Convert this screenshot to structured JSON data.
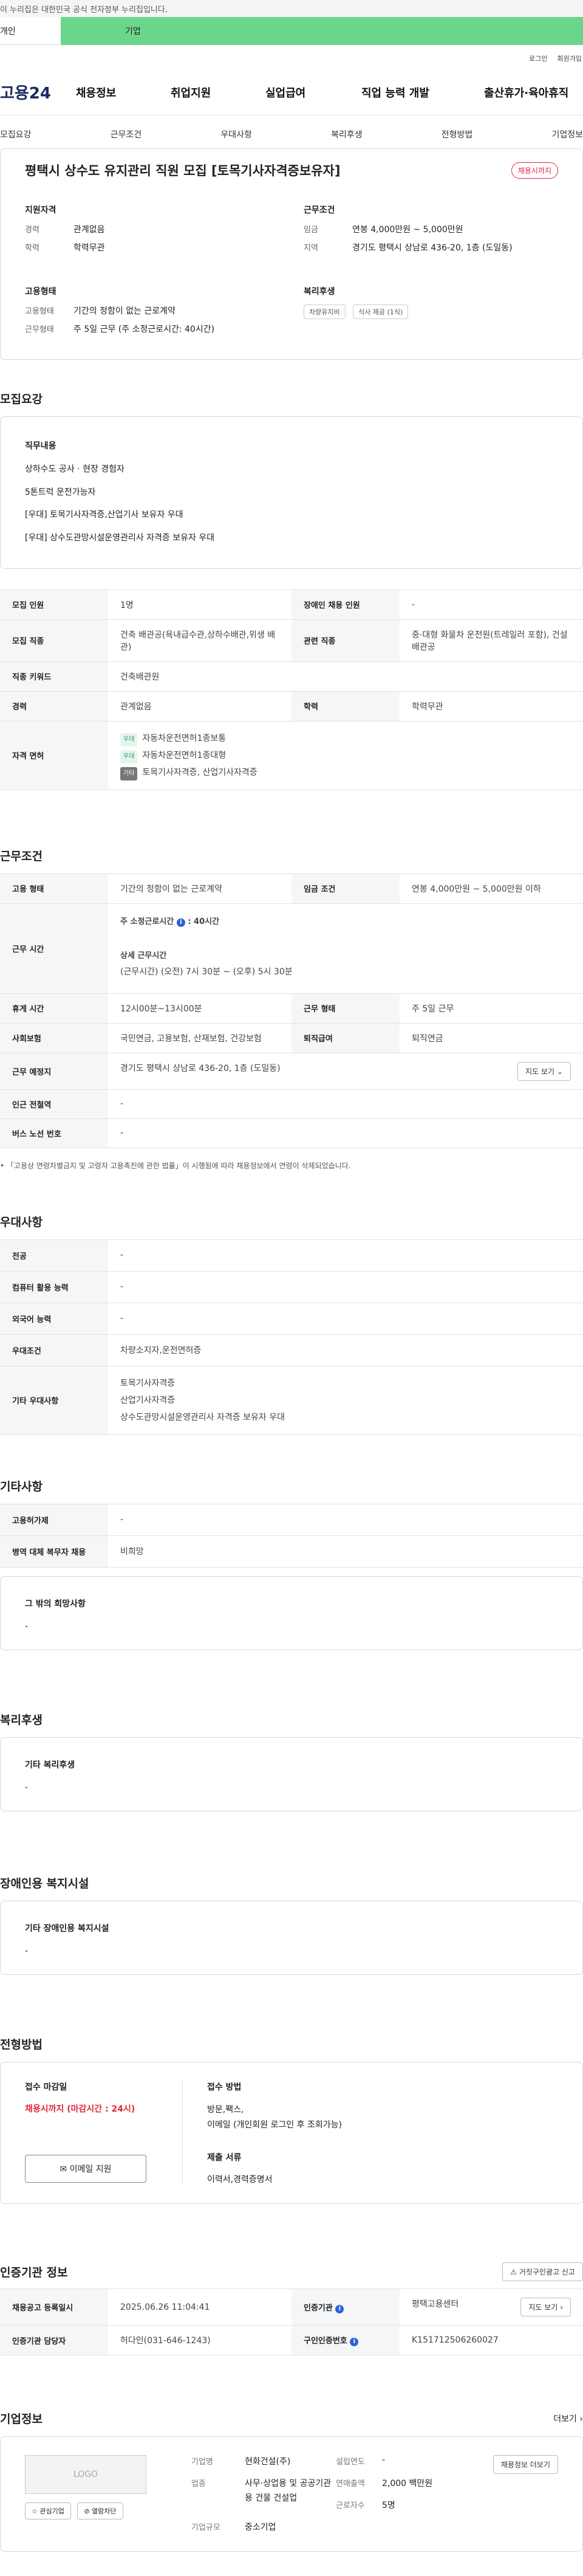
{
  "banner": "이 누리집은 대한민국 공식 전자정부 누리집입니다.",
  "tabs": {
    "personal": "개인",
    "company": "기업"
  },
  "util": [
    "로그인",
    "회원가입"
  ],
  "logo": "고용24",
  "gnb": [
    "채용정보",
    "취업지원",
    "실업급여",
    "직업 능력 개발",
    "출산휴가·육아휴직"
  ],
  "subnav": [
    "모집요강",
    "근무조건",
    "우대사항",
    "복리후생",
    "전형방법",
    "기업정보"
  ],
  "summary": {
    "title": "평택시 상수도 유지관리 직원 모집 [토목기사자격증보유자]",
    "badge": "채용시까지",
    "qual_h": "지원자격",
    "career_k": "경력",
    "career_v": "관계없음",
    "edu_k": "학력",
    "edu_v": "학력무관",
    "cond_h": "근무조건",
    "wage_k": "임금",
    "wage_v": "연봉 4,000만원 ~ 5,000만원",
    "area_k": "지역",
    "area_v": "경기도 평택시 상남로 436-20, 1층 (도일동)",
    "emp_h": "고용형태",
    "emptype_k": "고용형태",
    "emptype_v": "기간의 정함이 없는 근로계약",
    "worktype_k": "근무형태",
    "worktype_v": "주 5일 근무 (주 소정근로시간: 40시간)",
    "welfare_h": "복리후생",
    "chips": [
      "차량유지비",
      "식사 제공 (1식)"
    ]
  },
  "recruit": {
    "title": "모집요강",
    "duty_h": "직무내용",
    "duties": [
      "상하수도 공사 · 현장 경험자",
      "5톤트럭 운전가능자",
      "[우대] 토목기사자격증,산업기사 보유자 우대",
      "[우대] 상수도관망시설운영관리사 자격증 보유자 우대"
    ],
    "rows": {
      "count_k": "모집 인원",
      "count_v": "1명",
      "disabled_k": "장애인 채용 인원",
      "disabled_v": "-",
      "job_k": "모집 직종",
      "job_v": "건축 배관공(욕내급수관,상하수배관,위생 배관)",
      "rel_k": "관련 직종",
      "rel_v": "중·대형 화물차 운전원(트레일러 포함), 건설 배관공",
      "kw_k": "직종 키워드",
      "kw_v": "건축배관원",
      "car_k": "경력",
      "car_v": "관계없음",
      "edu_k": "학력",
      "edu_v": "학력무관",
      "lic_k": "자격 면허",
      "lic": [
        {
          "tag": "우대",
          "name": "자동차운전면허1종보통"
        },
        {
          "tag": "우대",
          "name": "자동차운전면허1종대형"
        },
        {
          "tag": "기타",
          "name": "토목기사자격증, 산업기사자격증"
        }
      ]
    }
  },
  "work": {
    "title": "근무조건",
    "emp_k": "고용 형태",
    "emp_v": "기간의 정함이 없는 근로계약",
    "wage_k": "임금 조건",
    "wage_v": "연봉 4,000만원 ~ 5,000만원 이하",
    "time_k": "근무 시간",
    "time_a": "주 소정근로시간",
    "time_a_v": ": 40시간",
    "time_b": "상세 근무시간",
    "time_b_v": "(근무시간) (오전) 7시 30분 ~ (오후) 5시 30분",
    "break_k": "휴게 시간",
    "break_v": "12시00분~13시00분",
    "form_k": "근무 형태",
    "form_v": "주 5일 근무",
    "ins_k": "사회보험",
    "ins_v": "국민연금, 고용보험, 산재보험, 건강보험",
    "ret_k": "퇴직급여",
    "ret_v": "퇴직연금",
    "place_k": "근무 예정지",
    "place_v": "경기도 평택시 상남로 436-20, 1층 (도일동)",
    "map_btn": "지도 보기",
    "sub_k": "인근 전철역",
    "sub_v": "-",
    "bus_k": "버스 노선 번호",
    "bus_v": "-",
    "note": "「고용상 연령차별금지 및 고령자 고용촉진에 관한 법률」이 시행됨에 따라 채용정보에서 연령이 삭제되었습니다."
  },
  "pref": {
    "title": "우대사항",
    "major_k": "전공",
    "major_v": "-",
    "comp_k": "컴퓨터 활용 능력",
    "comp_v": "-",
    "lang_k": "외국어 능력",
    "lang_v": "-",
    "cond_k": "우대조건",
    "cond_v": "차량소지자,운전면허증",
    "etc_k": "기타 우대사항",
    "etc": [
      "토목기사자격증",
      "산업기사자격증",
      "상수도관망시설운영관리사 자격증 보유자 우대"
    ]
  },
  "other": {
    "title": "기타사항",
    "sup_k": "고용허가제",
    "sup_v": "-",
    "mil_k": "병역 대체 복무자 채용",
    "mil_v": "비희망",
    "hope_h": "그 밖의 희망사항",
    "hope_v": "-"
  },
  "welfare": {
    "title": "복리후생",
    "h": "기타 복리후생",
    "v": "-"
  },
  "disab": {
    "title": "장애인용 복지시설",
    "h": "기타 장애인용 복지시설",
    "v": "-"
  },
  "screen": {
    "title": "전형방법",
    "deadline_h": "접수 마감일",
    "deadline_v": "채용시까지 (마감시간 : 24시)",
    "method_h": "접수 방법",
    "method_v1": "방문,팩스,",
    "method_v2": "이메일 (개인회원 로그인 후 조회가능)",
    "docs_h": "제출 서류",
    "docs_v": "이력서,경력증명서",
    "btn": "이메일 지원"
  },
  "cert": {
    "title": "인증기관 정보",
    "report_btn": "거짓구인광고 신고",
    "reg_k": "채용공고 등록일시",
    "reg_v": "2025.06.26 11:04:41",
    "org_k": "인증기관",
    "org_v": "평택고용센터",
    "mgr_k": "인증기관 담당자",
    "mgr_v": "허다인(031-646-1243)",
    "no_k": "구인인증번호",
    "no_v": "K151712506260027",
    "map_btn": "지도 보기"
  },
  "company": {
    "title": "기업정보",
    "more": "더보기",
    "logo": "LOGO",
    "fav_btn": "관심기업",
    "block_btn": "열람차단",
    "name_k": "기업명",
    "name_v": "현화건설(주)",
    "year_k": "설립연도",
    "year_v": "-",
    "ind_k": "업종",
    "ind_v": "사무·상업용 및 공공기관용 건물 건설업",
    "sales_k": "연매출액",
    "sales_v": "2,000 백만원",
    "emp_k": "근로자수",
    "emp_v": "5명",
    "size_k": "기업규모",
    "size_v": "중소기업",
    "jobs_btn": "채용정보 더보기"
  }
}
